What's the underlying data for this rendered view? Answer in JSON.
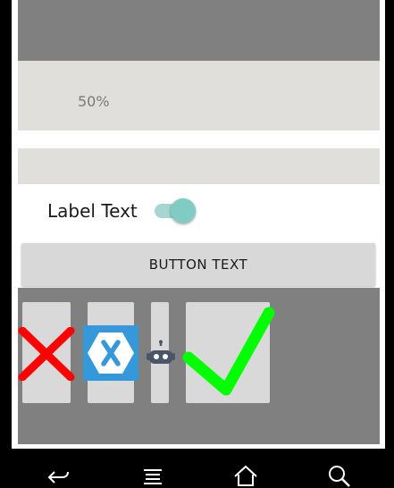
{
  "progress": {
    "label": "50%",
    "value": 0.5
  },
  "switch_row": {
    "label": "Label Text",
    "state": "on"
  },
  "button": {
    "label": "BUTTON TEXT"
  },
  "images": [
    {
      "icon": "red-x-icon",
      "color": "#ff0000"
    },
    {
      "icon": "xamarin-logo-icon",
      "color": "#3498db"
    },
    {
      "icon": "robot-icon",
      "color": "#4a5568"
    },
    {
      "icon": "green-checkmark-icon",
      "color": "#00ff00"
    }
  ],
  "navigation_bar": {
    "buttons": [
      "back-icon",
      "menu-icon",
      "home-icon",
      "search-icon"
    ]
  },
  "colors": {
    "panel_gray": "#808080",
    "panel_light": "#e0dfdc",
    "switch_accent": "#80cbc4"
  }
}
